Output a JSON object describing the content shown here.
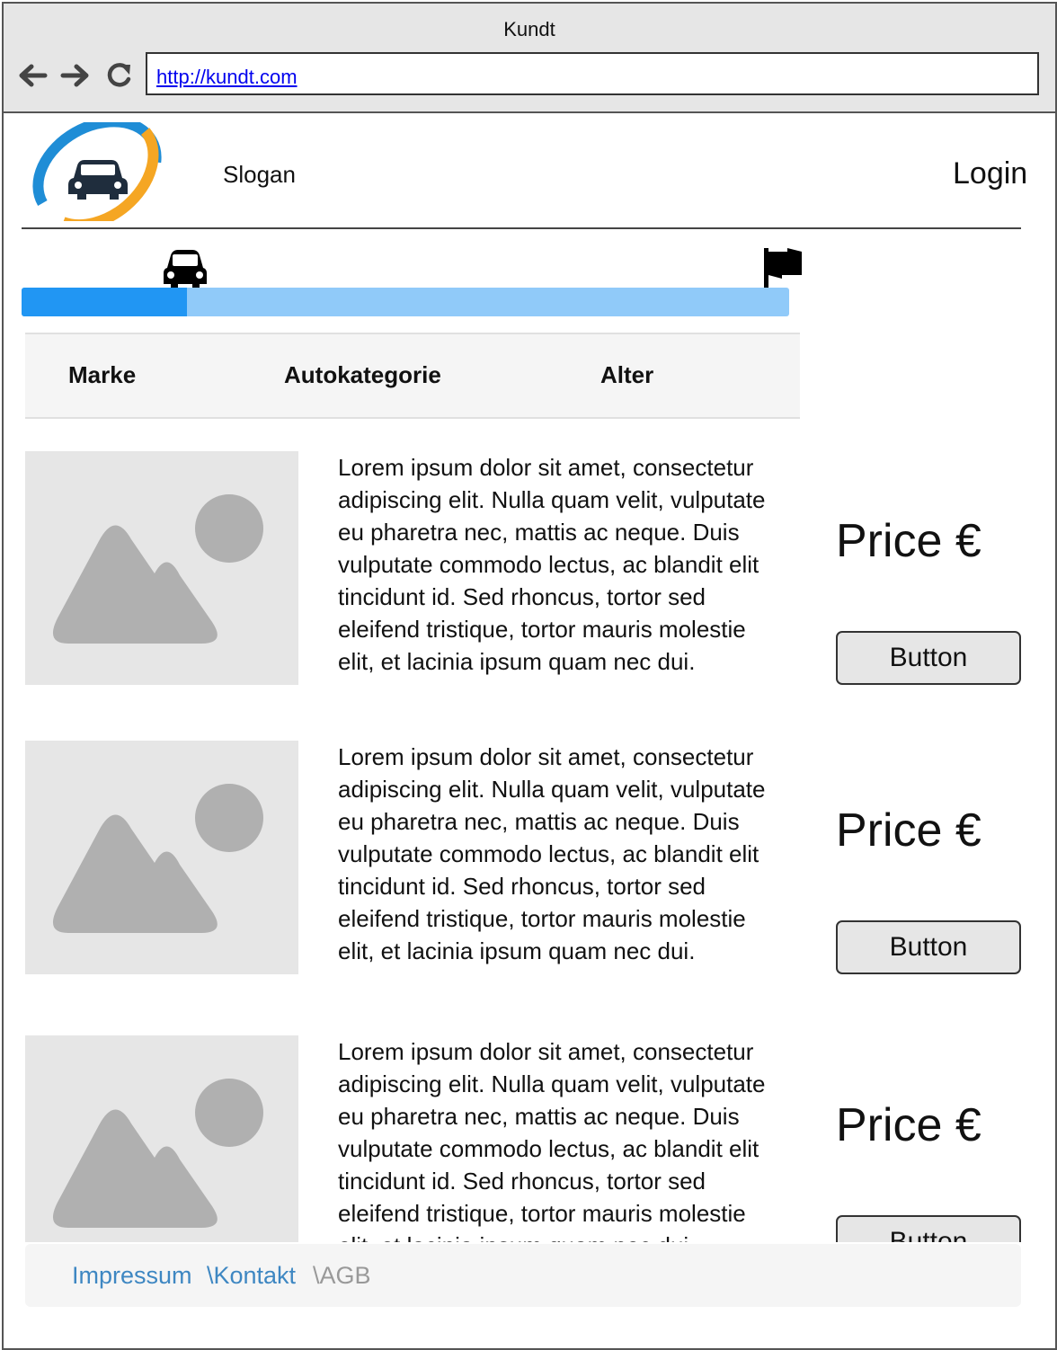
{
  "browser": {
    "title": "Kundt",
    "url": "http://kundt.com",
    "icons": [
      "back-arrow-icon",
      "forward-arrow-icon",
      "reload-icon"
    ]
  },
  "header": {
    "slogan": "Slogan",
    "login": "Login",
    "logo_icon": "car-logo-icon"
  },
  "progress": {
    "fraction": 0.215,
    "start_icon": "car-icon",
    "end_icon": "flag-icon",
    "colors": {
      "fill": "#2196f3",
      "track": "#90caf9"
    }
  },
  "filters": {
    "marke": "Marke",
    "autokategorie": "Autokategorie",
    "alter": "Alter"
  },
  "listings": [
    {
      "lines": [
        "Lorem ipsum dolor sit amet, consectetur",
        "adipiscing elit. Nulla quam velit, vulputate",
        "eu pharetra nec, mattis ac neque. Duis",
        "vulputate commodo lectus, ac blandit elit",
        "tincidunt id. Sed rhoncus, tortor sed",
        "eleifend tristique, tortor mauris molestie",
        "elit, et lacinia ipsum quam nec dui."
      ],
      "price": "Price €",
      "button": "Button"
    },
    {
      "lines": [
        "Lorem ipsum dolor sit amet, consectetur",
        "adipiscing elit. Nulla quam velit, vulputate",
        "eu pharetra nec, mattis ac neque. Duis",
        "vulputate commodo lectus, ac blandit elit",
        "tincidunt id. Sed rhoncus, tortor sed",
        "eleifend tristique, tortor mauris molestie",
        "elit, et lacinia ipsum quam nec dui."
      ],
      "price": "Price €",
      "button": "Button"
    },
    {
      "lines": [
        "Lorem ipsum dolor sit amet, consectetur",
        "adipiscing elit. Nulla quam velit, vulputate",
        "eu pharetra nec, mattis ac neque. Duis",
        "vulputate commodo lectus, ac blandit elit",
        "tincidunt id. Sed rhoncus, tortor sed",
        "eleifend tristique, tortor mauris molestie",
        "elit, et lacinia ipsum quam nec dui."
      ],
      "price": "Price €",
      "button": "Button"
    }
  ],
  "footer": {
    "impressum": "Impressum",
    "kontakt": "\\Kontakt",
    "agb": "\\AGB",
    "colors": {
      "link": "#3e87c2",
      "muted": "#999999"
    }
  }
}
